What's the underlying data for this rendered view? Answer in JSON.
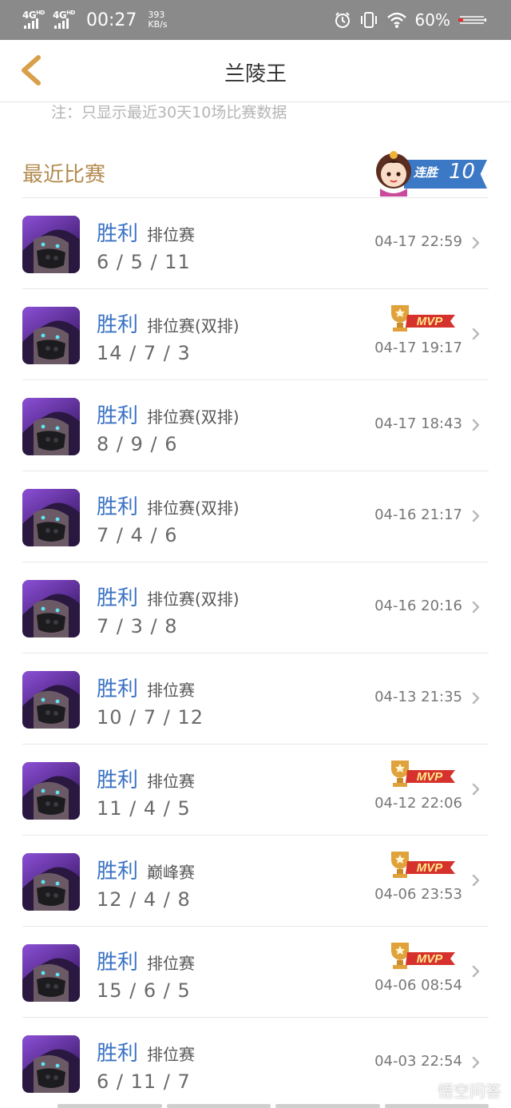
{
  "status_bar": {
    "net1": "4G",
    "net1_sup": "HD",
    "net2": "4G",
    "net2_sup": "HD",
    "time": "00:27",
    "speed_value": "393",
    "speed_unit": "KB/s",
    "battery": "60%"
  },
  "nav": {
    "title": "兰陵王"
  },
  "note": "注：只显示最近30天10场比赛数据",
  "section": {
    "title": "最近比赛",
    "streak_label": "连胜",
    "streak_count": "10"
  },
  "matches": [
    {
      "result": "胜利",
      "mode": "排位赛",
      "kda": "6 / 5 / 11",
      "date": "04-17 22:59",
      "mvp": false
    },
    {
      "result": "胜利",
      "mode": "排位赛(双排)",
      "kda": "14 / 7 / 3",
      "date": "04-17 19:17",
      "mvp": true
    },
    {
      "result": "胜利",
      "mode": "排位赛(双排)",
      "kda": "8 / 9 / 6",
      "date": "04-17 18:43",
      "mvp": false
    },
    {
      "result": "胜利",
      "mode": "排位赛(双排)",
      "kda": "7 / 4 / 6",
      "date": "04-16 21:17",
      "mvp": false
    },
    {
      "result": "胜利",
      "mode": "排位赛(双排)",
      "kda": "7 / 3 / 8",
      "date": "04-16 20:16",
      "mvp": false
    },
    {
      "result": "胜利",
      "mode": "排位赛",
      "kda": "10 / 7 / 12",
      "date": "04-13 21:35",
      "mvp": false
    },
    {
      "result": "胜利",
      "mode": "排位赛",
      "kda": "11 / 4 / 5",
      "date": "04-12 22:06",
      "mvp": true
    },
    {
      "result": "胜利",
      "mode": "巅峰赛",
      "kda": "12 / 4 / 8",
      "date": "04-06 23:53",
      "mvp": true
    },
    {
      "result": "胜利",
      "mode": "排位赛",
      "kda": "15 / 6 / 5",
      "date": "04-06 08:54",
      "mvp": true
    },
    {
      "result": "胜利",
      "mode": "排位赛",
      "kda": "6 / 11 / 7",
      "date": "04-03 22:54",
      "mvp": false
    }
  ],
  "mvp_label": "MVP",
  "watermark": "悟空问答",
  "colors": {
    "accent_gold": "#b38a4e",
    "result_blue": "#3a72c4",
    "streak_blue": "#3b78c5",
    "mvp_red": "#d6322d"
  }
}
